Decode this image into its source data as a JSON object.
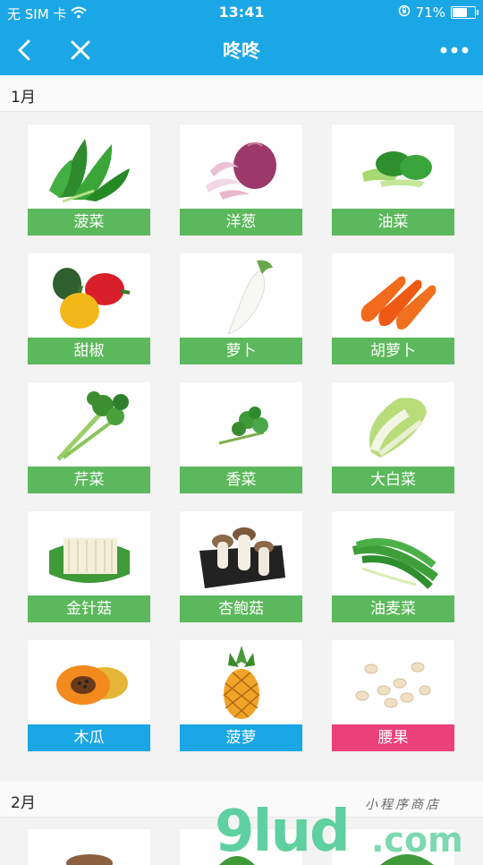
{
  "status_bar": {
    "carrier": "无 SIM 卡",
    "time": "13:41",
    "battery_percent": "71%",
    "battery_level": 0.71
  },
  "nav": {
    "title": "咚咚"
  },
  "sections": [
    {
      "month": "1月",
      "items": [
        {
          "name": "菠菜",
          "label_color": "#5cb85c",
          "icon": "spinach-icon"
        },
        {
          "name": "洋葱",
          "label_color": "#5cb85c",
          "icon": "onion-icon"
        },
        {
          "name": "油菜",
          "label_color": "#5cb85c",
          "icon": "bok-choy-icon"
        },
        {
          "name": "甜椒",
          "label_color": "#5cb85c",
          "icon": "bell-pepper-icon"
        },
        {
          "name": "萝卜",
          "label_color": "#5cb85c",
          "icon": "radish-icon"
        },
        {
          "name": "胡萝卜",
          "label_color": "#5cb85c",
          "icon": "carrot-icon"
        },
        {
          "name": "芹菜",
          "label_color": "#5cb85c",
          "icon": "celery-icon"
        },
        {
          "name": "香菜",
          "label_color": "#5cb85c",
          "icon": "cilantro-icon"
        },
        {
          "name": "大白菜",
          "label_color": "#5cb85c",
          "icon": "napa-cabbage-icon"
        },
        {
          "name": "金针菇",
          "label_color": "#5cb85c",
          "icon": "enoki-mushroom-icon"
        },
        {
          "name": "杏鲍菇",
          "label_color": "#5cb85c",
          "icon": "king-oyster-mushroom-icon"
        },
        {
          "name": "油麦菜",
          "label_color": "#5cb85c",
          "icon": "leaf-lettuce-icon"
        },
        {
          "name": "木瓜",
          "label_color": "#1ba6e6",
          "icon": "papaya-icon"
        },
        {
          "name": "菠萝",
          "label_color": "#1ba6e6",
          "icon": "pineapple-icon"
        },
        {
          "name": "腰果",
          "label_color": "#ec407a",
          "icon": "cashew-icon"
        }
      ]
    },
    {
      "month": "2月"
    }
  ],
  "watermark": {
    "main": "9lud",
    "com": ".com",
    "subtitle": "小程序商店"
  }
}
